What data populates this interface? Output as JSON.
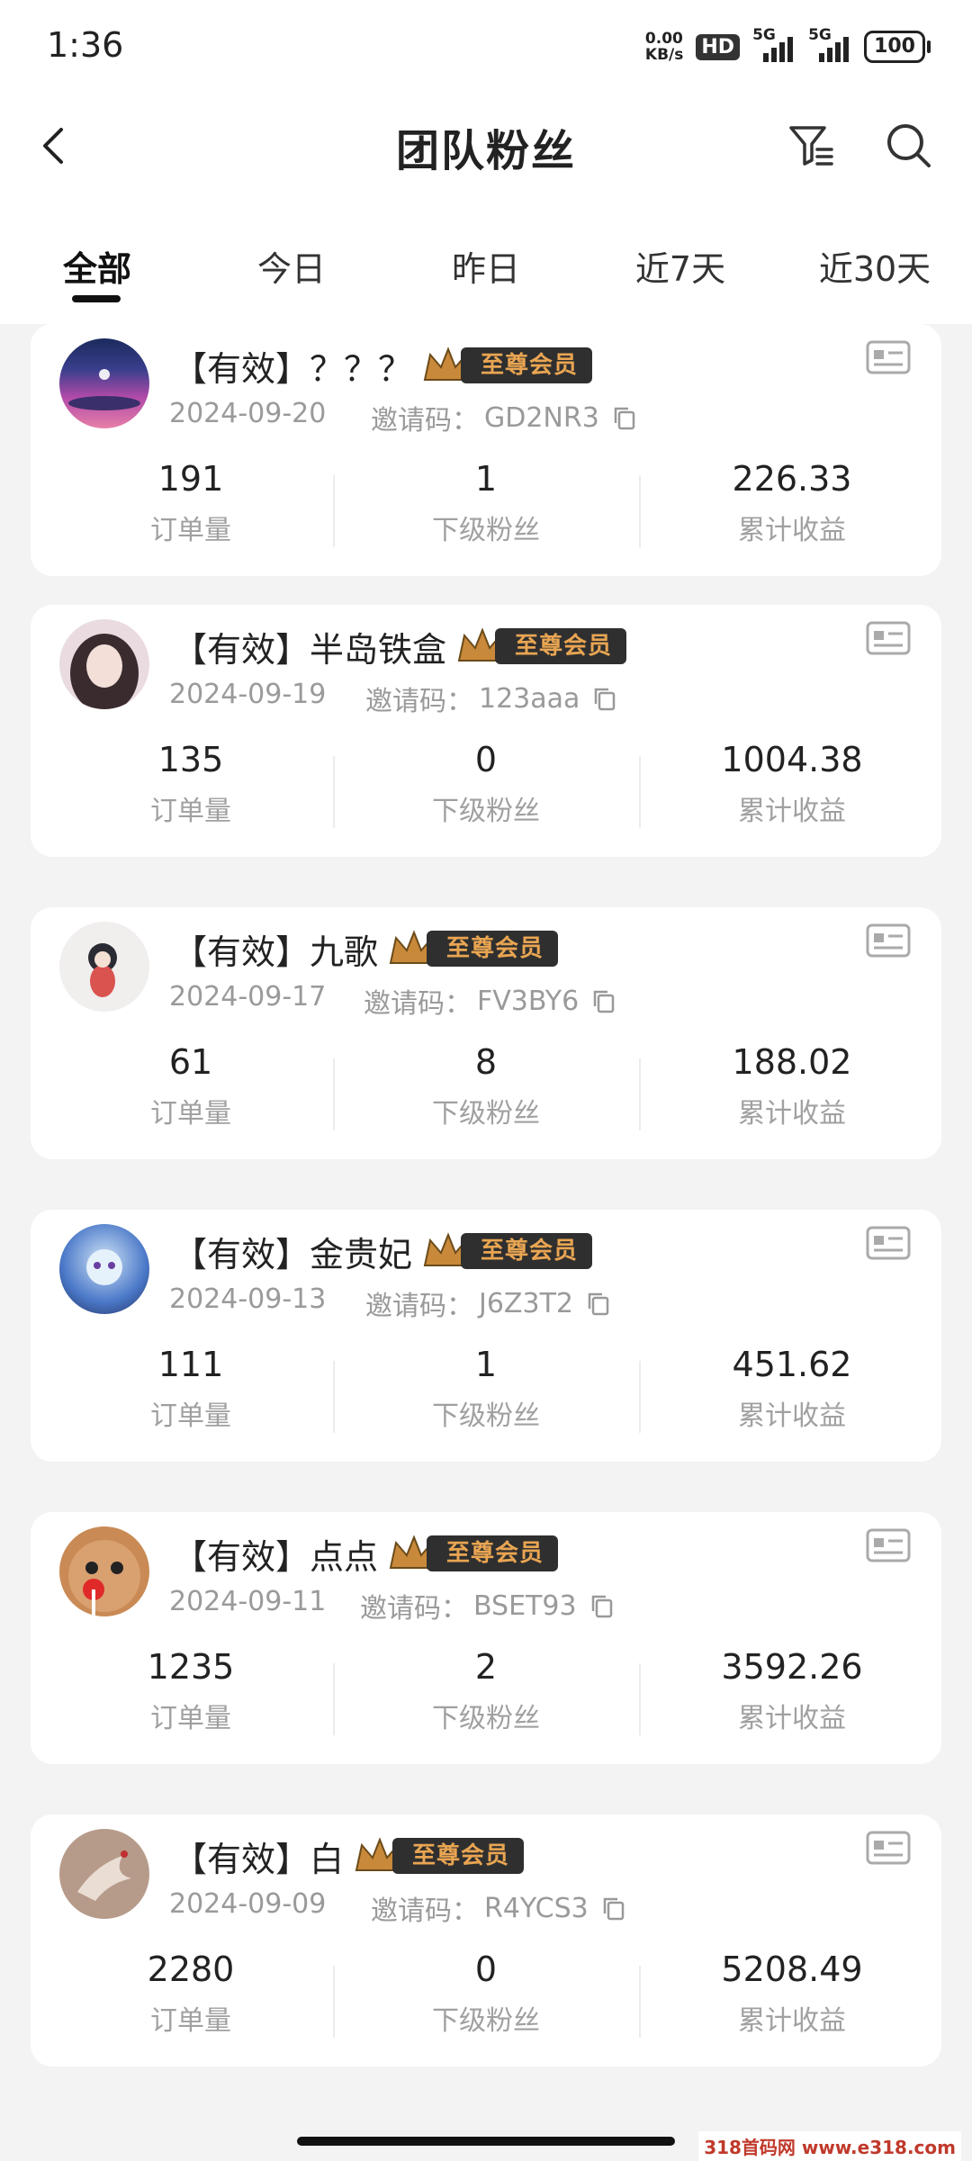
{
  "status": {
    "time": "1:36",
    "net_speed_top": "0.00",
    "net_speed_bottom": "KB/s",
    "hd": "HD",
    "sig1": "5G",
    "sig2": "5G",
    "battery": "100"
  },
  "header": {
    "title": "团队粉丝"
  },
  "tabs": [
    {
      "label": "全部",
      "active": true
    },
    {
      "label": "今日"
    },
    {
      "label": "昨日"
    },
    {
      "label": "近7天"
    },
    {
      "label": "近30天"
    }
  ],
  "labels": {
    "invite_prefix": "邀请码：",
    "orders": "订单量",
    "fans": "下级粉丝",
    "earnings": "累计收益",
    "badge": "至尊会员"
  },
  "cards": [
    {
      "name": "【有效】？？？",
      "date": "2024-09-20",
      "code": "GD2NR3",
      "orders": "191",
      "fans": "1",
      "earnings": "226.33"
    },
    {
      "name": "【有效】半岛铁盒",
      "date": "2024-09-19",
      "code": "123aaa",
      "orders": "135",
      "fans": "0",
      "earnings": "1004.38"
    },
    {
      "name": "【有效】九歌",
      "date": "2024-09-17",
      "code": "FV3BY6",
      "orders": "61",
      "fans": "8",
      "earnings": "188.02"
    },
    {
      "name": "【有效】金贵妃",
      "date": "2024-09-13",
      "code": "J6Z3T2",
      "orders": "111",
      "fans": "1",
      "earnings": "451.62"
    },
    {
      "name": "【有效】点点",
      "date": "2024-09-11",
      "code": "BSET93",
      "orders": "1235",
      "fans": "2",
      "earnings": "3592.26"
    },
    {
      "name": "【有效】白",
      "date": "2024-09-09",
      "code": "R4YCS3",
      "orders": "2280",
      "fans": "0",
      "earnings": "5208.49"
    }
  ],
  "watermark": "318首码网 www.e318.com"
}
